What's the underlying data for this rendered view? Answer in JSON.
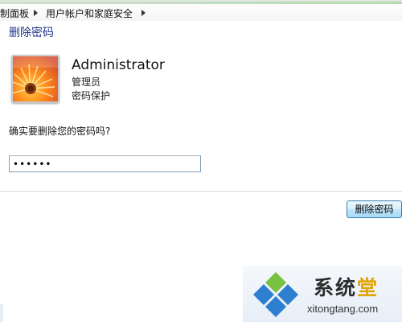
{
  "breadcrumb": {
    "items": [
      "制面板",
      "用户帐户和家庭安全"
    ]
  },
  "page": {
    "title": "删除密码"
  },
  "account": {
    "name": "Administrator",
    "role": "管理员",
    "status": "密码保护"
  },
  "prompt": {
    "question": "确实要删除您的密码吗?",
    "password_value": "••••••"
  },
  "actions": {
    "delete_label": "删除密码"
  },
  "watermark": {
    "title_main": "系统",
    "title_highlight": "堂",
    "url": "xitongtang.com"
  },
  "icons": {
    "avatar": "orange-flower-icon",
    "separator": "chevron-right-icon",
    "watermark_logo": "windows-diamond-logo-icon"
  },
  "colors": {
    "title": "#1e3287",
    "button_border": "#3c7fb1",
    "logo_green": "#7ac143",
    "logo_blue": "#2f7fd0",
    "logo_accent": "#e0a300"
  }
}
